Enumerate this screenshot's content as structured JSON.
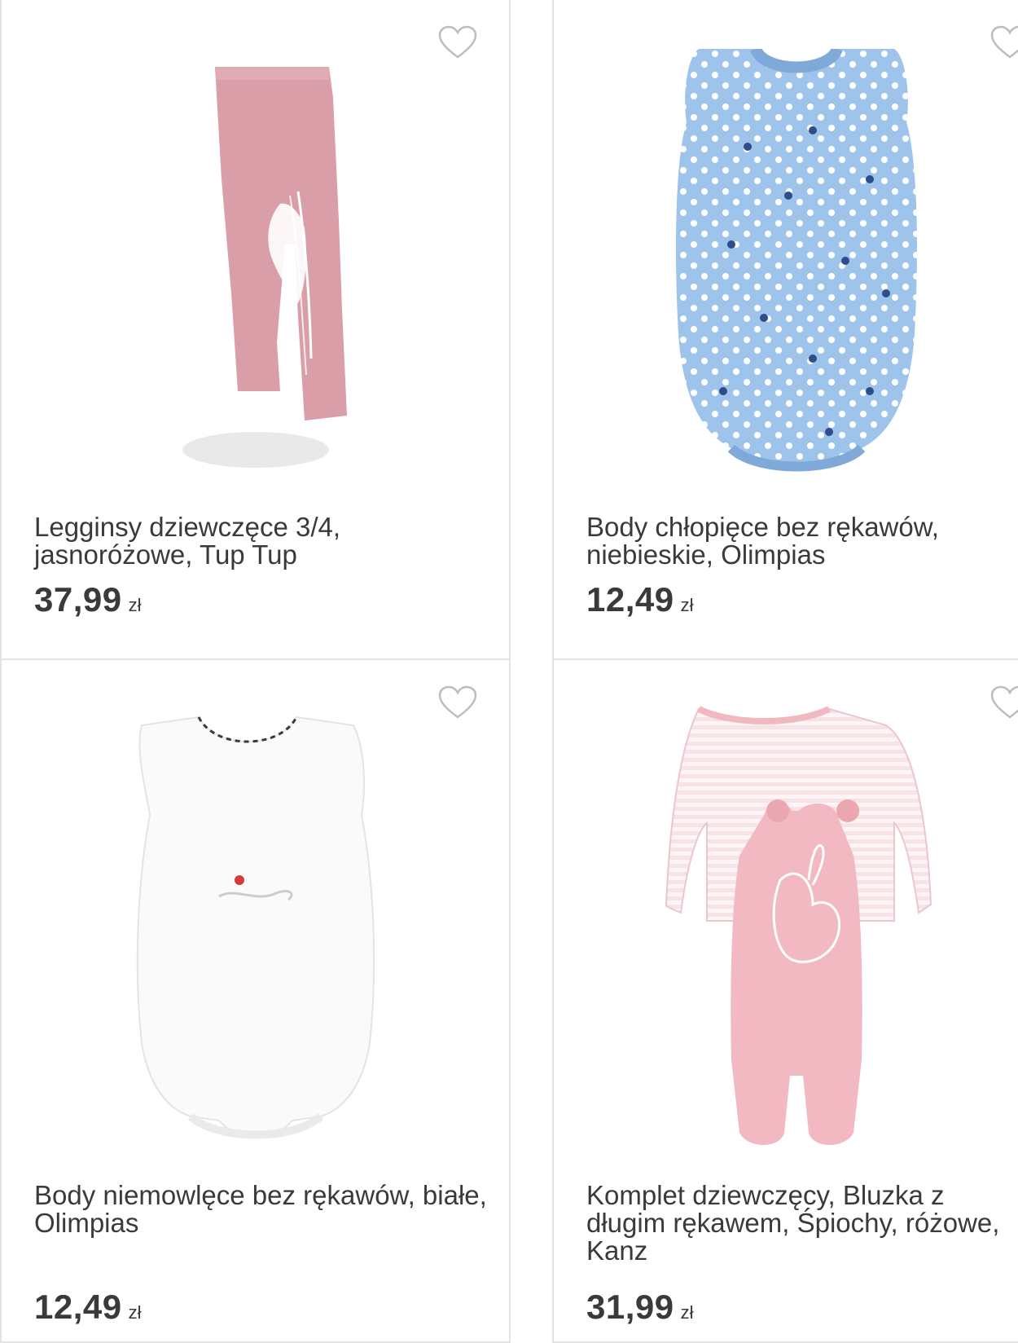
{
  "products": [
    {
      "title": "Legginsy dziewczęce 3/4, jasnoróżowe, Tup Tup",
      "price": "37,99",
      "currency": "zł",
      "image": "pink-leggings-with-horse-print"
    },
    {
      "title": "Body chłopięce bez rękawów, niebieskie, Olimpias",
      "price": "12,49",
      "currency": "zł",
      "image": "blue-sleeveless-bodysuit-with-dots-and-stars"
    },
    {
      "title": "Body niemowlęce bez rękawów, białe, Olimpias",
      "price": "12,49",
      "currency": "zł",
      "image": "white-sleeveless-bodysuit"
    },
    {
      "title": "Komplet dziewczęcy, Bluzka z długim rękawem, Śpiochy, różowe, Kanz",
      "price": "31,99",
      "currency": "zł",
      "image": "pink-set-striped-top-and-bunny-romper"
    }
  ],
  "icons": {
    "favorite": "heart-outline-icon"
  },
  "colors": {
    "card_border": "#e3e3e3",
    "text": "#3a3a3a",
    "heart": "#bdbdbd"
  }
}
